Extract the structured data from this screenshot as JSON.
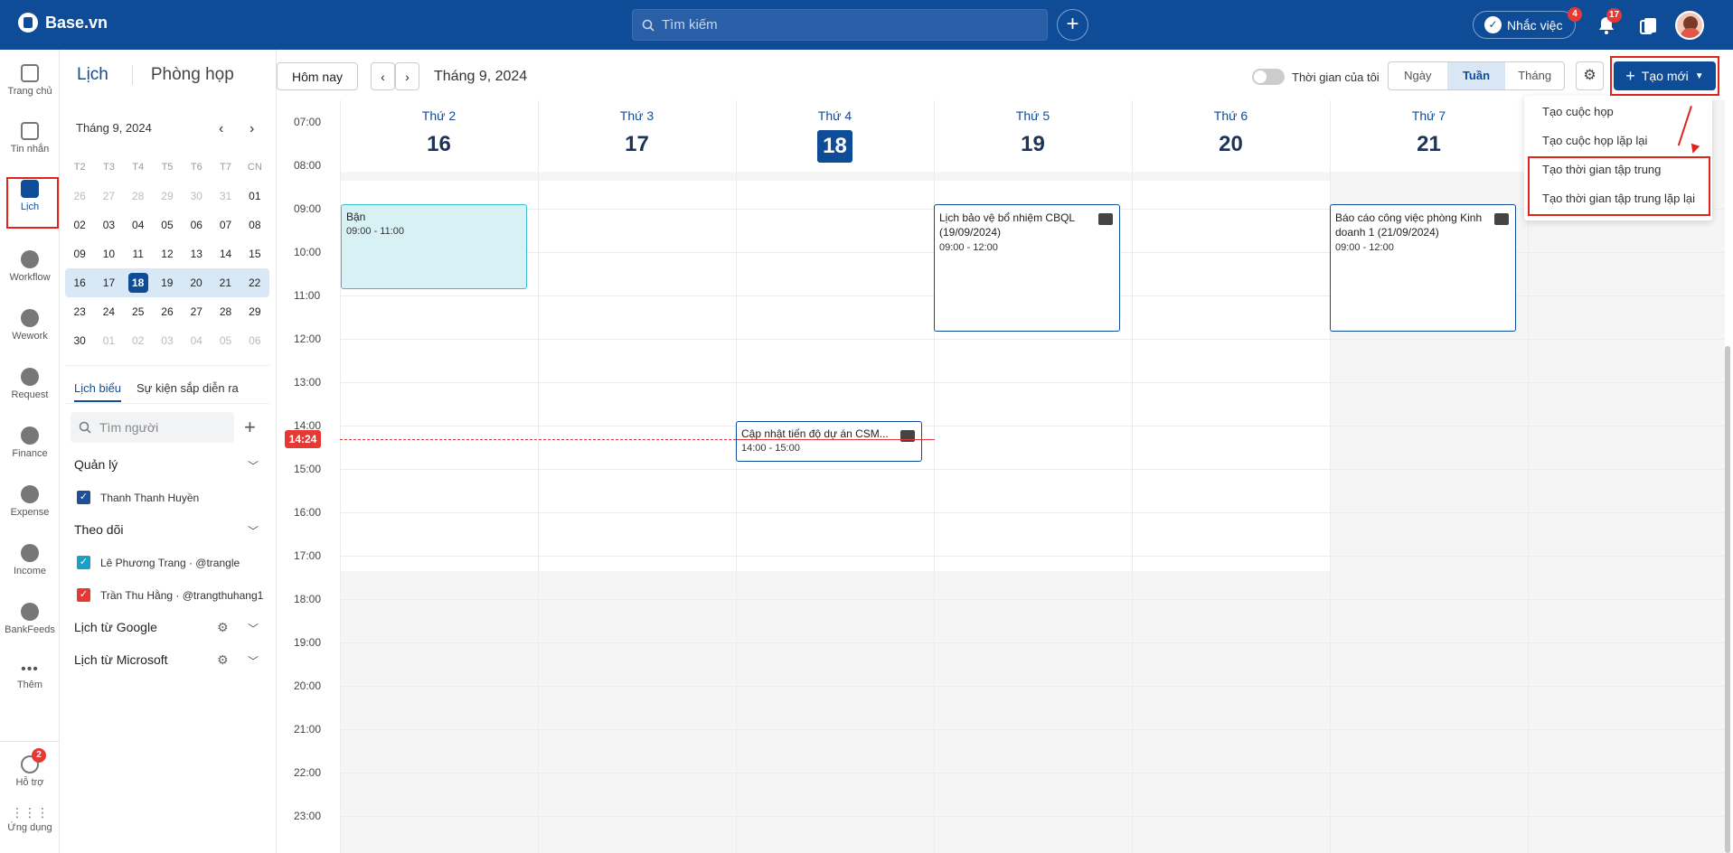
{
  "topbar": {
    "logo": "Base.vn",
    "search_placeholder": "Tìm kiếm",
    "remind_label": "Nhắc việc",
    "remind_badge": "4",
    "notif_badge": "17"
  },
  "leftnav": {
    "items": [
      {
        "label": "Trang chủ",
        "icon": "home-icon"
      },
      {
        "label": "Tin nhắn",
        "icon": "message-icon"
      },
      {
        "label": "Lịch",
        "icon": "calendar-icon"
      },
      {
        "label": "Workflow",
        "icon": "workflow-icon"
      },
      {
        "label": "Wework",
        "icon": "wework-icon"
      },
      {
        "label": "Request",
        "icon": "request-icon"
      },
      {
        "label": "Finance",
        "icon": "finance-icon"
      },
      {
        "label": "Expense",
        "icon": "expense-icon"
      },
      {
        "label": "Income",
        "icon": "income-icon"
      },
      {
        "label": "BankFeeds",
        "icon": "bankfeeds-icon"
      },
      {
        "label": "Thêm",
        "icon": "more-icon"
      }
    ],
    "help_label": "Hỗ trợ",
    "help_badge": "2",
    "apps_label": "Ứng dụng"
  },
  "header_tabs": {
    "calendar": "Lịch",
    "rooms": "Phòng họp"
  },
  "mini_calendar": {
    "title": "Tháng 9, 2024",
    "weekdays": [
      "T2",
      "T3",
      "T4",
      "T5",
      "T6",
      "T7",
      "CN"
    ],
    "rows": [
      [
        "26",
        "27",
        "28",
        "29",
        "30",
        "31",
        "01"
      ],
      [
        "02",
        "03",
        "04",
        "05",
        "06",
        "07",
        "08"
      ],
      [
        "09",
        "10",
        "11",
        "12",
        "13",
        "14",
        "15"
      ],
      [
        "16",
        "17",
        "18",
        "19",
        "20",
        "21",
        "22"
      ],
      [
        "23",
        "24",
        "25",
        "26",
        "27",
        "28",
        "29"
      ],
      [
        "30",
        "01",
        "02",
        "03",
        "04",
        "05",
        "06"
      ]
    ],
    "today": "18"
  },
  "sidebar": {
    "tab_schedule": "Lịch biểu",
    "tab_upcoming": "Sự kiện sắp diễn ra",
    "people_placeholder": "Tìm người",
    "section_manage": "Quản lý",
    "manage_people": [
      {
        "name": "Thanh Thanh Huyền",
        "color": "#1f4f9a"
      }
    ],
    "section_follow": "Theo dõi",
    "follow_people": [
      {
        "name": "Lê Phương Trang · @trangle",
        "color": "#1aa0c8"
      },
      {
        "name": "Trần Thu Hằng · @trangthuhang1",
        "color": "#e53935"
      }
    ],
    "google": "Lịch từ Google",
    "microsoft": "Lịch từ Microsoft"
  },
  "toolbar": {
    "today": "Hôm nay",
    "current_month": "Tháng 9, 2024",
    "my_time": "Thời gian của tôi",
    "view_day": "Ngày",
    "view_week": "Tuần",
    "view_month": "Tháng",
    "create": "Tạo mới"
  },
  "create_menu": [
    "Tạo cuộc họp",
    "Tạo cuộc họp lặp lại",
    "Tạo thời gian tập trung",
    "Tạo thời gian tập trung lặp lại"
  ],
  "week": {
    "days": [
      {
        "name": "Thứ 2",
        "date": "16"
      },
      {
        "name": "Thứ 3",
        "date": "17"
      },
      {
        "name": "Thứ 4",
        "date": "18"
      },
      {
        "name": "Thứ 5",
        "date": "19"
      },
      {
        "name": "Thứ 6",
        "date": "20"
      },
      {
        "name": "Thứ 7",
        "date": "21"
      }
    ],
    "hours": [
      "07:00",
      "08:00",
      "09:00",
      "10:00",
      "11:00",
      "12:00",
      "13:00",
      "14:00",
      "15:00",
      "16:00",
      "17:00",
      "18:00",
      "19:00",
      "20:00",
      "21:00",
      "22:00",
      "23:00"
    ],
    "now": "14:24"
  },
  "events": {
    "busy": {
      "title": "Bận",
      "time": "09:00 - 11:00"
    },
    "cbql": {
      "title": "Lịch bảo vệ bổ nhiệm CBQL (19/09/2024)",
      "time": "09:00 - 12:00"
    },
    "report": {
      "title": "Báo cáo công việc phòng Kinh doanh 1 (21/09/2024)",
      "time": "09:00 - 12:00"
    },
    "csm": {
      "title": "Cập nhật tiến độ dự án CSM...",
      "time": "14:00 - 15:00"
    }
  }
}
